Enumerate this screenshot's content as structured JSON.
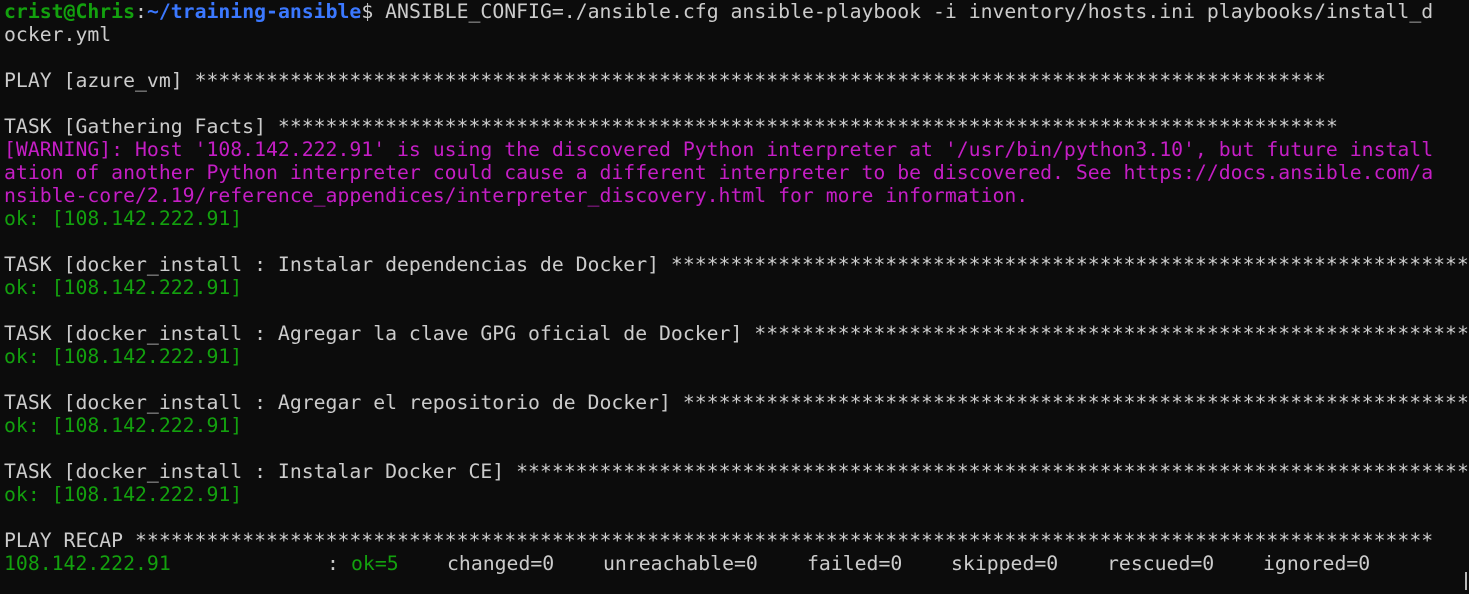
{
  "prompt": {
    "user_host": "crist@Chris",
    "path": "~/training-ansible",
    "symbol": "$",
    "command_line1": " ANSIBLE_CONFIG=./ansible.cfg ansible-playbook -i inventory/hosts.ini playbooks/install_d",
    "command_line2": "ocker.yml"
  },
  "play": {
    "header": "PLAY [azure_vm] ",
    "stars": "***********************************************************************************************"
  },
  "tasks": [
    {
      "header": "TASK [Gathering Facts] ",
      "stars": "*****************************************************************************************",
      "warning": [
        "[WARNING]: Host '108.142.222.91' is using the discovered Python interpreter at '/usr/bin/python3.10', but future install",
        "ation of another Python interpreter could cause a different interpreter to be discovered. See https://docs.ansible.com/a",
        "nsible-core/2.19/reference_appendices/interpreter_discovery.html for more information."
      ],
      "result": "ok: [108.142.222.91]"
    },
    {
      "header": "TASK [docker_install : Instalar dependencias de Docker] ",
      "stars": "*******************************************************************",
      "warning": [],
      "result": "ok: [108.142.222.91]"
    },
    {
      "header": "TASK [docker_install : Agregar la clave GPG oficial de Docker] ",
      "stars": "************************************************************",
      "warning": [],
      "result": "ok: [108.142.222.91]"
    },
    {
      "header": "TASK [docker_install : Agregar el repositorio de Docker] ",
      "stars": "******************************************************************",
      "warning": [],
      "result": "ok: [108.142.222.91]"
    },
    {
      "header": "TASK [docker_install : Instalar Docker CE] ",
      "stars": "********************************************************************************",
      "warning": [],
      "result": "ok: [108.142.222.91]"
    }
  ],
  "recap": {
    "header": "PLAY RECAP ",
    "stars": "*************************************************************************************************************",
    "host": "108.142.222.91",
    "colon": ":",
    "ok": "ok=5",
    "changed": "changed=0",
    "unreachable": "unreachable=0",
    "failed": "failed=0",
    "skipped": "skipped=0",
    "rescued": "rescued=0",
    "ignored": "ignored=0"
  },
  "colors": {
    "background": "#0c0c0c",
    "foreground": "#cccccc",
    "green": "#13a10e",
    "blue": "#3b78ff",
    "magenta": "#c51ec5"
  }
}
